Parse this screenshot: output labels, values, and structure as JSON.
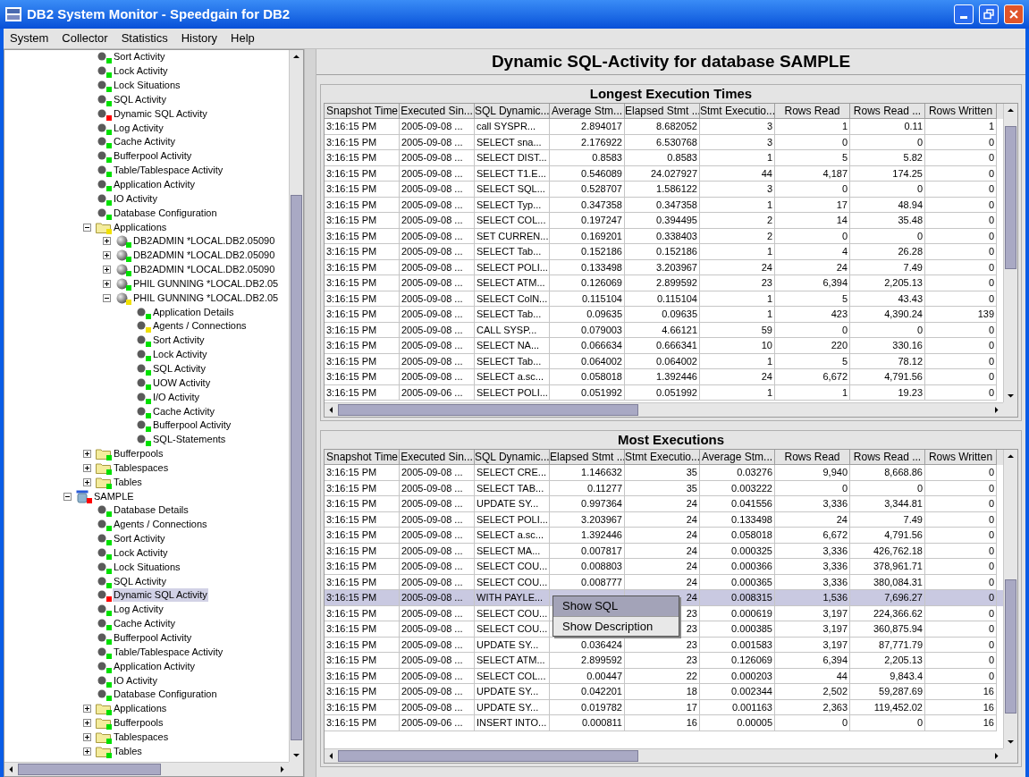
{
  "window": {
    "title": "DB2 System Monitor - Speedgain for DB2"
  },
  "menu": [
    "System",
    "Collector",
    "Statistics",
    "History",
    "Help"
  ],
  "tree": {
    "continued_nodes": [
      {
        "label": "Sort Activity",
        "kind": "status",
        "color": "#00e000",
        "selected": false
      },
      {
        "label": "Lock Activity",
        "kind": "status",
        "color": "#00e000",
        "selected": false
      },
      {
        "label": "Lock Situations",
        "kind": "status",
        "color": "#00e000",
        "selected": false
      },
      {
        "label": "SQL Activity",
        "kind": "status",
        "color": "#00e000",
        "selected": false
      },
      {
        "label": "Dynamic SQL Activity",
        "kind": "status",
        "color": "#ff0000",
        "selected": false
      },
      {
        "label": "Log Activity",
        "kind": "status",
        "color": "#00e000",
        "selected": false
      },
      {
        "label": "Cache Activity",
        "kind": "status",
        "color": "#00e000",
        "selected": false
      },
      {
        "label": "Bufferpool Activity",
        "kind": "status",
        "color": "#00e000",
        "selected": false
      },
      {
        "label": "Table/Tablespace Activity",
        "kind": "status",
        "color": "#00e000",
        "selected": false
      },
      {
        "label": "Application Activity",
        "kind": "status",
        "color": "#00e000",
        "selected": false
      },
      {
        "label": "IO Activity",
        "kind": "status",
        "color": "#00e000",
        "selected": false
      },
      {
        "label": "Database Configuration",
        "kind": "status",
        "color": "#00e000",
        "selected": false
      },
      {
        "label": "Applications",
        "kind": "folder",
        "color": "#f0e000",
        "selected": false,
        "expanded": true,
        "children": [
          {
            "label": "DB2ADMIN *LOCAL.DB2.05090",
            "kind": "application",
            "color": "#00e000",
            "selected": false,
            "expanded": false
          },
          {
            "label": "DB2ADMIN *LOCAL.DB2.05090",
            "kind": "application",
            "color": "#00e000",
            "selected": false,
            "expanded": false
          },
          {
            "label": "DB2ADMIN *LOCAL.DB2.05090",
            "kind": "application",
            "color": "#00e000",
            "selected": false,
            "expanded": false
          },
          {
            "label": "PHIL GUNNING *LOCAL.DB2.05",
            "kind": "application",
            "color": "#00e000",
            "selected": false,
            "expanded": false
          },
          {
            "label": "PHIL GUNNING *LOCAL.DB2.05",
            "kind": "application",
            "color": "#f0e000",
            "selected": false,
            "expanded": true,
            "children": [
              {
                "label": "Application Details",
                "kind": "status",
                "color": "#00e000",
                "selected": false
              },
              {
                "label": "Agents / Connections",
                "kind": "status",
                "color": "#f0e000",
                "selected": false
              },
              {
                "label": "Sort Activity",
                "kind": "status",
                "color": "#00e000",
                "selected": false
              },
              {
                "label": "Lock Activity",
                "kind": "status",
                "color": "#00e000",
                "selected": false
              },
              {
                "label": "SQL Activity",
                "kind": "status",
                "color": "#00e000",
                "selected": false
              },
              {
                "label": "UOW Activity",
                "kind": "status",
                "color": "#00e000",
                "selected": false
              },
              {
                "label": "I/O Activity",
                "kind": "status",
                "color": "#00e000",
                "selected": false
              },
              {
                "label": "Cache Activity",
                "kind": "status",
                "color": "#00e000",
                "selected": false
              },
              {
                "label": "Bufferpool Activity",
                "kind": "status",
                "color": "#00e000",
                "selected": false
              },
              {
                "label": "SQL-Statements",
                "kind": "status",
                "color": "#00e000",
                "selected": false
              }
            ]
          }
        ]
      },
      {
        "label": "Bufferpools",
        "kind": "folder",
        "color": "#00e000",
        "selected": false,
        "expanded": false
      },
      {
        "label": "Tablespaces",
        "kind": "folder",
        "color": "#00e000",
        "selected": false,
        "expanded": false
      },
      {
        "label": "Tables",
        "kind": "folder",
        "color": "#00e000",
        "selected": false,
        "expanded": false
      }
    ],
    "nodes": [
      {
        "label": "SAMPLE",
        "kind": "database",
        "color": "#ff0000",
        "selected": false,
        "expanded": true,
        "children": [
          {
            "label": "Database Details",
            "kind": "status",
            "color": "#00e000",
            "selected": false
          },
          {
            "label": "Agents / Connections",
            "kind": "status",
            "color": "#00e000",
            "selected": false
          },
          {
            "label": "Sort Activity",
            "kind": "status",
            "color": "#00e000",
            "selected": false
          },
          {
            "label": "Lock Activity",
            "kind": "status",
            "color": "#00e000",
            "selected": false
          },
          {
            "label": "Lock Situations",
            "kind": "status",
            "color": "#00e000",
            "selected": false
          },
          {
            "label": "SQL Activity",
            "kind": "status",
            "color": "#00e000",
            "selected": false
          },
          {
            "label": "Dynamic SQL Activity",
            "kind": "status",
            "color": "#ff0000",
            "selected": true
          },
          {
            "label": "Log Activity",
            "kind": "status",
            "color": "#00e000",
            "selected": false
          },
          {
            "label": "Cache Activity",
            "kind": "status",
            "color": "#00e000",
            "selected": false
          },
          {
            "label": "Bufferpool Activity",
            "kind": "status",
            "color": "#00e000",
            "selected": false
          },
          {
            "label": "Table/Tablespace Activity",
            "kind": "status",
            "color": "#00e000",
            "selected": false
          },
          {
            "label": "Application Activity",
            "kind": "status",
            "color": "#00e000",
            "selected": false
          },
          {
            "label": "IO Activity",
            "kind": "status",
            "color": "#00e000",
            "selected": false
          },
          {
            "label": "Database Configuration",
            "kind": "status",
            "color": "#00e000",
            "selected": false
          },
          {
            "label": "Applications",
            "kind": "folder",
            "color": "#00e000",
            "selected": false,
            "expanded": false
          },
          {
            "label": "Bufferpools",
            "kind": "folder",
            "color": "#00e000",
            "selected": false,
            "expanded": false
          },
          {
            "label": "Tablespaces",
            "kind": "folder",
            "color": "#00e000",
            "selected": false,
            "expanded": false
          },
          {
            "label": "Tables",
            "kind": "folder",
            "color": "#00e000",
            "selected": false,
            "expanded": false
          }
        ]
      }
    ]
  },
  "heading": "Dynamic SQL-Activity for database SAMPLE",
  "tables": [
    {
      "title": "Longest Execution Times",
      "columns": [
        "Snapshot Time",
        "Executed Sin...",
        "SQL Dynamic...",
        "Average Stm...",
        "Elapsed Stmt ...",
        "Stmt Executio...",
        "Rows Read",
        "Rows Read ...",
        "Rows Written"
      ],
      "rows": [
        {
          "cells": [
            "3:16:15 PM",
            "2005-09-08 ...",
            "call  SYSPR...",
            "2.894017",
            "8.682052",
            "3",
            "1",
            "0.11",
            "1"
          ],
          "selected": false
        },
        {
          "cells": [
            "3:16:15 PM",
            "2005-09-08 ...",
            "SELECT sna...",
            "2.176922",
            "6.530768",
            "3",
            "0",
            "0",
            "0"
          ],
          "selected": false
        },
        {
          "cells": [
            "3:16:15 PM",
            "2005-09-08 ...",
            "SELECT DIST...",
            "0.8583",
            "0.8583",
            "1",
            "5",
            "5.82",
            "0"
          ],
          "selected": false
        },
        {
          "cells": [
            "3:16:15 PM",
            "2005-09-08 ...",
            "SELECT T1.E...",
            "0.546089",
            "24.027927",
            "44",
            "4,187",
            "174.25",
            "0"
          ],
          "selected": false
        },
        {
          "cells": [
            "3:16:15 PM",
            "2005-09-08 ...",
            "SELECT SQL...",
            "0.528707",
            "1.586122",
            "3",
            "0",
            "0",
            "0"
          ],
          "selected": false
        },
        {
          "cells": [
            "3:16:15 PM",
            "2005-09-08 ...",
            "SELECT Typ...",
            "0.347358",
            "0.347358",
            "1",
            "17",
            "48.94",
            "0"
          ],
          "selected": false
        },
        {
          "cells": [
            "3:16:15 PM",
            "2005-09-08 ...",
            "SELECT COL...",
            "0.197247",
            "0.394495",
            "2",
            "14",
            "35.48",
            "0"
          ],
          "selected": false
        },
        {
          "cells": [
            "3:16:15 PM",
            "2005-09-08 ...",
            "SET CURREN...",
            "0.169201",
            "0.338403",
            "2",
            "0",
            "0",
            "0"
          ],
          "selected": false
        },
        {
          "cells": [
            "3:16:15 PM",
            "2005-09-08 ...",
            "SELECT Tab...",
            "0.152186",
            "0.152186",
            "1",
            "4",
            "26.28",
            "0"
          ],
          "selected": false
        },
        {
          "cells": [
            "3:16:15 PM",
            "2005-09-08 ...",
            "SELECT POLI...",
            "0.133498",
            "3.203967",
            "24",
            "24",
            "7.49",
            "0"
          ],
          "selected": false
        },
        {
          "cells": [
            "3:16:15 PM",
            "2005-09-08 ...",
            "SELECT ATM...",
            "0.126069",
            "2.899592",
            "23",
            "6,394",
            "2,205.13",
            "0"
          ],
          "selected": false
        },
        {
          "cells": [
            "3:16:15 PM",
            "2005-09-08 ...",
            "SELECT ColN...",
            "0.115104",
            "0.115104",
            "1",
            "5",
            "43.43",
            "0"
          ],
          "selected": false
        },
        {
          "cells": [
            "3:16:15 PM",
            "2005-09-08 ...",
            "SELECT Tab...",
            "0.09635",
            "0.09635",
            "1",
            "423",
            "4,390.24",
            "139"
          ],
          "selected": false
        },
        {
          "cells": [
            "3:16:15 PM",
            "2005-09-08 ...",
            "CALL SYSP...",
            "0.079003",
            "4.66121",
            "59",
            "0",
            "0",
            "0"
          ],
          "selected": false
        },
        {
          "cells": [
            "3:16:15 PM",
            "2005-09-08 ...",
            "SELECT NA...",
            "0.066634",
            "0.666341",
            "10",
            "220",
            "330.16",
            "0"
          ],
          "selected": false
        },
        {
          "cells": [
            "3:16:15 PM",
            "2005-09-08 ...",
            "SELECT Tab...",
            "0.064002",
            "0.064002",
            "1",
            "5",
            "78.12",
            "0"
          ],
          "selected": false
        },
        {
          "cells": [
            "3:16:15 PM",
            "2005-09-08 ...",
            "SELECT a.sc...",
            "0.058018",
            "1.392446",
            "24",
            "6,672",
            "4,791.56",
            "0"
          ],
          "selected": false
        },
        {
          "cells": [
            "3:16:15 PM",
            "2005-09-06 ...",
            "SELECT POLI...",
            "0.051992",
            "0.051992",
            "1",
            "1",
            "19.23",
            "0"
          ],
          "selected": false
        }
      ]
    },
    {
      "title": "Most Executions",
      "columns": [
        "Snapshot Time",
        "Executed Sin...",
        "SQL Dynamic...",
        "Elapsed Stmt ...",
        "Stmt Executio...",
        "Average Stm...",
        "Rows Read",
        "Rows Read ...",
        "Rows Written"
      ],
      "rows": [
        {
          "cells": [
            "3:16:15 PM",
            "2005-09-08 ...",
            "SELECT CRE...",
            "1.146632",
            "35",
            "0.03276",
            "9,940",
            "8,668.86",
            "0"
          ],
          "selected": false
        },
        {
          "cells": [
            "3:16:15 PM",
            "2005-09-08 ...",
            "SELECT TAB...",
            "0.11277",
            "35",
            "0.003222",
            "0",
            "0",
            "0"
          ],
          "selected": false
        },
        {
          "cells": [
            "3:16:15 PM",
            "2005-09-08 ...",
            "UPDATE SY...",
            "0.997364",
            "24",
            "0.041556",
            "3,336",
            "3,344.81",
            "0"
          ],
          "selected": false
        },
        {
          "cells": [
            "3:16:15 PM",
            "2005-09-08 ...",
            "SELECT POLI...",
            "3.203967",
            "24",
            "0.133498",
            "24",
            "7.49",
            "0"
          ],
          "selected": false
        },
        {
          "cells": [
            "3:16:15 PM",
            "2005-09-08 ...",
            "SELECT a.sc...",
            "1.392446",
            "24",
            "0.058018",
            "6,672",
            "4,791.56",
            "0"
          ],
          "selected": false
        },
        {
          "cells": [
            "3:16:15 PM",
            "2005-09-08 ...",
            "SELECT MA...",
            "0.007817",
            "24",
            "0.000325",
            "3,336",
            "426,762.18",
            "0"
          ],
          "selected": false
        },
        {
          "cells": [
            "3:16:15 PM",
            "2005-09-08 ...",
            "SELECT COU...",
            "0.008803",
            "24",
            "0.000366",
            "3,336",
            "378,961.71",
            "0"
          ],
          "selected": false
        },
        {
          "cells": [
            "3:16:15 PM",
            "2005-09-08 ...",
            "SELECT COU...",
            "0.008777",
            "24",
            "0.000365",
            "3,336",
            "380,084.31",
            "0"
          ],
          "selected": false
        },
        {
          "cells": [
            "3:16:15 PM",
            "2005-09-08 ...",
            "WITH PAYLE...",
            null,
            "24",
            "0.008315",
            "1,536",
            "7,696.27",
            "0"
          ],
          "selected": true
        },
        {
          "cells": [
            "3:16:15 PM",
            "2005-09-08 ...",
            "SELECT COU...",
            null,
            "23",
            "0.000619",
            "3,197",
            "224,366.62",
            "0"
          ],
          "selected": false
        },
        {
          "cells": [
            "3:16:15 PM",
            "2005-09-08 ...",
            "SELECT COU...",
            null,
            "23",
            "0.000385",
            "3,197",
            "360,875.94",
            "0"
          ],
          "selected": false
        },
        {
          "cells": [
            "3:16:15 PM",
            "2005-09-08 ...",
            "UPDATE SY...",
            "0.036424",
            "23",
            "0.001583",
            "3,197",
            "87,771.79",
            "0"
          ],
          "selected": false
        },
        {
          "cells": [
            "3:16:15 PM",
            "2005-09-08 ...",
            "SELECT ATM...",
            "2.899592",
            "23",
            "0.126069",
            "6,394",
            "2,205.13",
            "0"
          ],
          "selected": false
        },
        {
          "cells": [
            "3:16:15 PM",
            "2005-09-08 ...",
            "SELECT COL...",
            "0.00447",
            "22",
            "0.000203",
            "44",
            "9,843.4",
            "0"
          ],
          "selected": false
        },
        {
          "cells": [
            "3:16:15 PM",
            "2005-09-08 ...",
            "UPDATE SY...",
            "0.042201",
            "18",
            "0.002344",
            "2,502",
            "59,287.69",
            "16"
          ],
          "selected": false
        },
        {
          "cells": [
            "3:16:15 PM",
            "2005-09-08 ...",
            "UPDATE SY...",
            "0.019782",
            "17",
            "0.001163",
            "2,363",
            "119,452.02",
            "16"
          ],
          "selected": false
        },
        {
          "cells": [
            "3:16:15 PM",
            "2005-09-06 ...",
            "INSERT INTO...",
            "0.000811",
            "16",
            "0.00005",
            "0",
            "0",
            "16"
          ],
          "selected": false
        }
      ],
      "context_menu": {
        "items": [
          {
            "label": "Show SQL",
            "selected": true
          },
          {
            "label": "Show Description",
            "selected": false
          }
        ]
      }
    }
  ]
}
